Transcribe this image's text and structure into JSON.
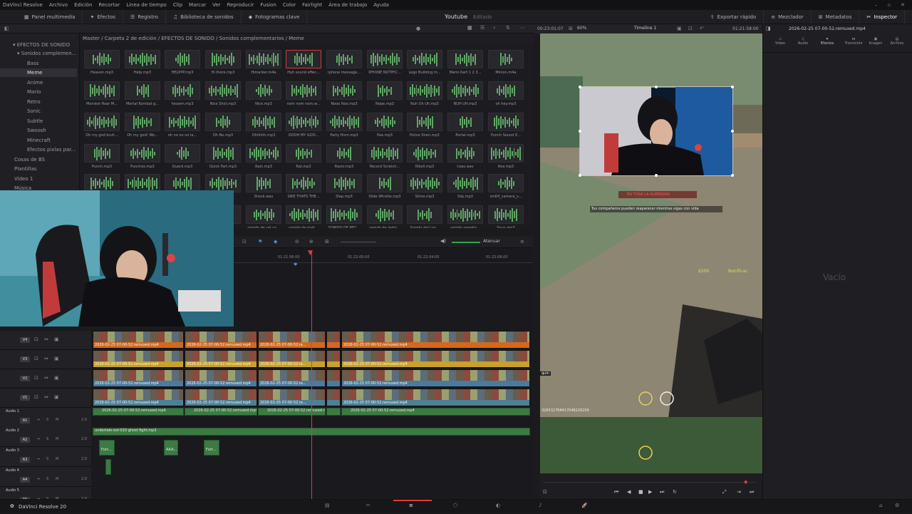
{
  "menubar": {
    "items": [
      "DaVinci Resolve",
      "Archivo",
      "Edición",
      "Recortar",
      "Línea de tiempo",
      "Clip",
      "Marcar",
      "Ver",
      "Reproducir",
      "Fusion",
      "Color",
      "Fairlight",
      "Área de trabajo",
      "Ayuda"
    ]
  },
  "toolbar": {
    "left": [
      "Panel multimedia",
      "Efectos",
      "Registro",
      "Biblioteca de sonidos",
      "Fotogramas clave"
    ],
    "project": "Youtube",
    "project_state": "Editado",
    "right": [
      "Exportar rápido",
      "Mezclador",
      "Metadatos",
      "Inspector"
    ]
  },
  "sidebar": {
    "root": "EFECTOS DE SONIDO",
    "items": [
      "Sonidos complemen...",
      "Bass",
      "Meme",
      "Anime",
      "Mario",
      "Retro",
      "Sonic",
      "Subtle",
      "Swoosh",
      "Minecraft",
      "Efectos pixlas par...",
      "Cosas de BS",
      "Plantillas",
      "Video 1",
      "Música"
    ],
    "selected": "Meme"
  },
  "breadcrumb": "Master / Carpeta 2 de edición / EFECTOS DE SONIDO / Sonidos complementarios / Meme",
  "media": [
    [
      "Heaven.mp3",
      "Help.mp3",
      "HELPPP.mp3",
      "Hi there.mp3",
      "Himarker.m4a",
      "Huh sound effec...",
      "iphone message...",
      "IPHONE NOTIFIC...",
      "Lego Building m...",
      "Mario Kart 1 2 3...",
      "Minion.m4a"
    ],
    [
      "Monster Roar M...",
      "Mortal Kombat g...",
      "heowm.mp3",
      "Nice Shot.mp3",
      "Nice.mp3",
      "nom nom nom.w...",
      "Nooo Noo.mp3",
      "Nope.mp3",
      "Nuh Uh Uh.mp3",
      "NUH UH.mp3",
      "oh hey.mp3"
    ],
    [
      "Oh my god bruh...",
      "Oh my god! Wo...",
      "oh no no no la...",
      "Oh No.mp3",
      "Ohhhhh.mp3",
      "OOOH MY GOO...",
      "Party Horn.mp3",
      "Pee.mp3",
      "Police Siren.mp3",
      "Portal.mp3",
      "Punch  Sound E..."
    ],
    [
      "Punch.mp3",
      "Punches.mp3",
      "Quack.mp3",
      "Quick Fart.mp3",
      "Rain.mp3",
      "Rat.mp3",
      "Razor.mp3",
      "Record Scratch...",
      "Rikoll.mp3",
      "rizas.wav",
      "Roe.mp3"
    ],
    [
      "",
      "",
      "",
      "",
      "Shock.wav",
      "SIKE THATS THE...",
      "Slap.mp3",
      "Slide Whistle.mp3",
      "Slime.mp3",
      "Slip.mp3",
      "sm64_camera_s..."
    ],
    [
      "",
      "",
      "",
      "",
      "sonido de cel co...",
      "sonido de mak...",
      "SONIDO DE REC...",
      "sonido de redol...",
      "Sonido del Laz...",
      "sonido negativ...",
      "Spun.mp3"
    ]
  ],
  "timeline": {
    "name": "Timeline 1",
    "timecode_left": "00:23:01:07",
    "timecode_right": "01:21:58:00",
    "zoom": "60%",
    "ruler": [
      "01:21:56:00",
      "01:22:00:00",
      "01:22:04:00",
      "01:22:08:00"
    ],
    "atenuar": "Atenuar",
    "clip_name": "2026-02-25 07-00-52.remuxed.mp4",
    "short_clip": "2026-02-25 07-00-52.re...",
    "audio_clip": "2026-02-25 07-00-52.remuxed.mp4",
    "music_clip": "undertale-ost-010 ghost fight.mp3",
    "sfx": [
      "Fort...",
      "AAA...",
      "Fort..."
    ],
    "video_tracks": [
      "V4",
      "V3",
      "V2",
      "V1"
    ],
    "audio_tracks": [
      "A1",
      "A2",
      "A3",
      "A4",
      "A5"
    ],
    "audio_labels": [
      "Audio 1",
      "Audio 2",
      "Audio 3",
      "Audio 4",
      "Audio 5"
    ],
    "level": "2.0"
  },
  "viewer": {
    "banner": "EN TODA LA ALMENDRA",
    "notice": "Tus compañeros pueden reaparecer mientras sigas con vida",
    "hud_left": "$500",
    "hud_right": "Bonificac",
    "id_text": "326532768417048226200",
    "quin": "quin"
  },
  "inspector": {
    "file": "2026-02-25 07-00-52.remuxed.mp4",
    "tabs": [
      "Video",
      "Audio",
      "Efectos",
      "Transición",
      "Imagen",
      "Archivo"
    ],
    "empty": "Vacío"
  },
  "status": {
    "app": "DaVinci Resolve 20"
  },
  "colors": {
    "accent_red": "#e23b3b",
    "v4": "#d2691e",
    "v3": "#c8a02a",
    "v2": "#4a7aa0",
    "v1": "#4d7f96",
    "audio": "#3c7a44"
  }
}
